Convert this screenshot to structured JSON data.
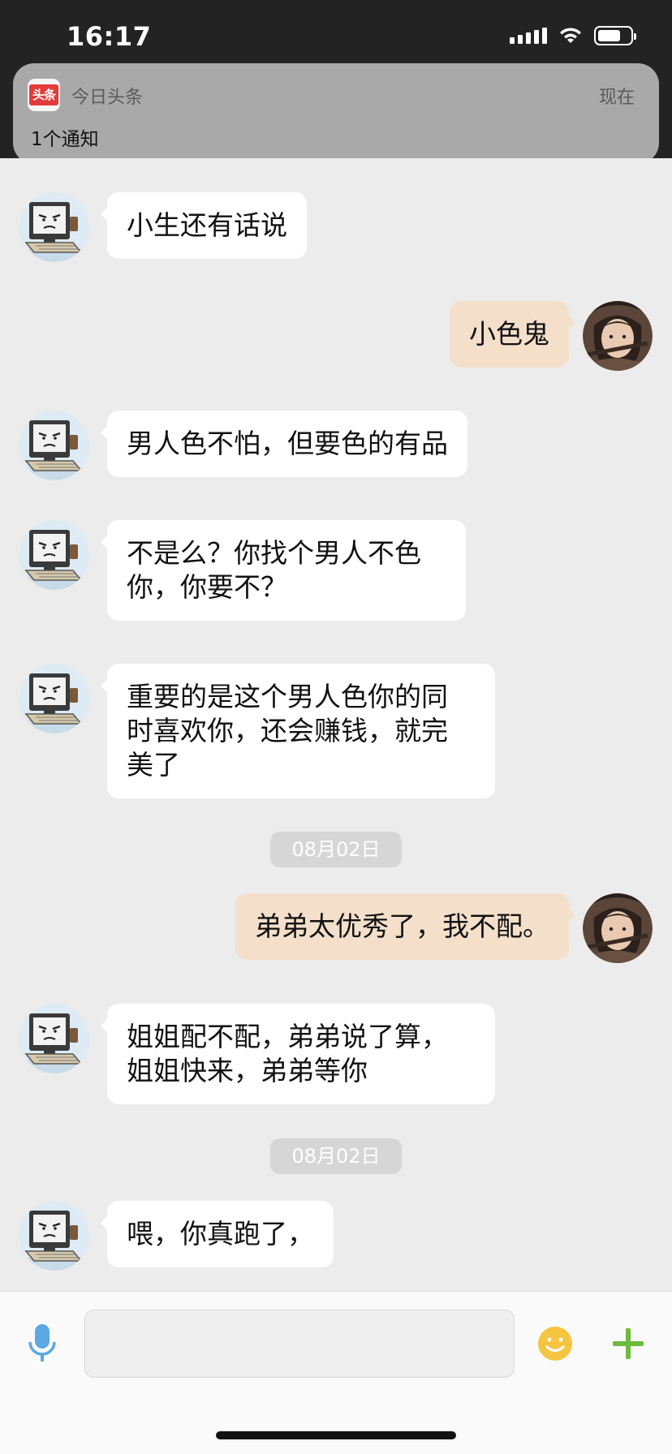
{
  "status_bar": {
    "time": "16:17",
    "battery_level": 0.7
  },
  "notification": {
    "app_icon_text": "头条",
    "app_name": "今日头条",
    "time": "现在",
    "body": "1个通知"
  },
  "messages": [
    {
      "side": "left",
      "text": "小生还有话说"
    },
    {
      "side": "right",
      "text": "小色鬼"
    },
    {
      "side": "left",
      "text": "男人色不怕，但要色的有品"
    },
    {
      "side": "left",
      "line1": "不是么？你找个男人不色",
      "line2": "你，你要不？"
    },
    {
      "side": "left",
      "line1": "重要的是这个男人色你的同",
      "line2": "时喜欢你，还会赚钱，就完",
      "line3": "美了"
    },
    {
      "type": "date",
      "text": "08月02日"
    },
    {
      "side": "right",
      "text": "弟弟太优秀了，我不配。"
    },
    {
      "side": "left",
      "line1": "姐姐配不配，弟弟说了算，",
      "line2": "姐姐快来，弟弟等你"
    },
    {
      "type": "date",
      "text": "08月02日"
    },
    {
      "side": "left",
      "text": "喂，你真跑了，"
    }
  ],
  "input": {
    "value": "",
    "placeholder": ""
  },
  "icons": {
    "mic": "mic-icon",
    "emoji": "smiley-icon",
    "plus": "plus-icon",
    "wifi": "wifi-icon",
    "signal": "signal-icon",
    "battery": "battery-icon"
  },
  "colors": {
    "status_bar_bg": "#232323",
    "chat_bg": "#ececec",
    "incoming_bubble": "#ffffff",
    "outgoing_bubble": "#f4dfcb",
    "mic_blue": "#5ba8e4",
    "emoji_yellow": "#f5c542",
    "plus_green": "#6dbb3d",
    "app_icon_red": "#e33b3a"
  }
}
